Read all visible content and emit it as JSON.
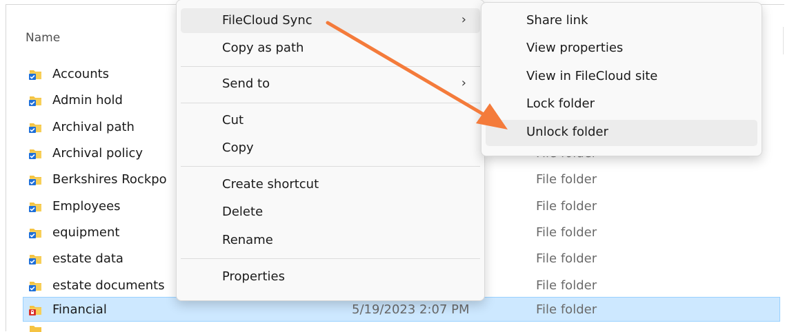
{
  "list": {
    "column_name": "Name",
    "rows": [
      {
        "name": "Accounts",
        "date": "",
        "type": "",
        "icon": "folder-sync-icon"
      },
      {
        "name": "Admin hold",
        "date": "",
        "type": "",
        "icon": "folder-sync-icon"
      },
      {
        "name": "Archival path",
        "date": "",
        "type": "",
        "icon": "folder-sync-icon"
      },
      {
        "name": "Archival policy",
        "date": "",
        "type": "File folder",
        "icon": "folder-sync-icon"
      },
      {
        "name": "Berkshires Rockpo",
        "date": "",
        "type": "File folder",
        "icon": "folder-sync-icon"
      },
      {
        "name": "Employees",
        "date": "",
        "type": "File folder",
        "icon": "folder-sync-icon"
      },
      {
        "name": "equipment",
        "date": "",
        "type": "File folder",
        "icon": "folder-sync-icon"
      },
      {
        "name": "estate data",
        "date": "",
        "type": "File folder",
        "icon": "folder-sync-icon"
      },
      {
        "name": "estate documents",
        "date": "",
        "type": "File folder",
        "icon": "folder-sync-icon"
      },
      {
        "name": "Financial",
        "date": "5/19/2023 2:07 PM",
        "type": "File folder",
        "icon": "folder-locked-icon"
      }
    ]
  },
  "context_menu": {
    "items": [
      {
        "label": "FileCloud Sync",
        "submenu": true
      },
      {
        "label": "Copy as path",
        "submenu": false
      },
      {
        "label": "Send to",
        "submenu": true
      },
      {
        "label": "Cut",
        "submenu": false
      },
      {
        "label": "Copy",
        "submenu": false
      },
      {
        "label": "Create shortcut",
        "submenu": false
      },
      {
        "label": "Delete",
        "submenu": false
      },
      {
        "label": "Rename",
        "submenu": false
      },
      {
        "label": "Properties",
        "submenu": false
      }
    ],
    "chevron": "›"
  },
  "submenu": {
    "items": [
      {
        "label": "Share link"
      },
      {
        "label": "View properties"
      },
      {
        "label": "View in FileCloud site"
      },
      {
        "label": "Lock folder"
      },
      {
        "label": "Unlock folder"
      }
    ],
    "highlighted": "Unlock folder"
  },
  "colors": {
    "selection_bg": "#cde8ff",
    "selection_border": "#99d1ff",
    "folder_yellow": "#f5c342",
    "sync_badge_blue": "#1e6fd9",
    "lock_badge_red": "#d9312b",
    "annotation_arrow": "#f47b3b"
  }
}
